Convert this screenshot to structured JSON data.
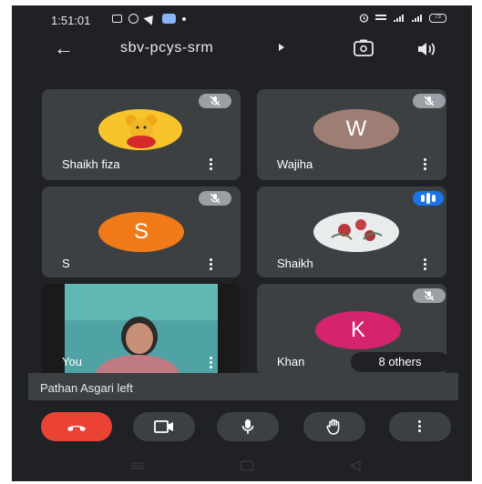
{
  "status_bar": {
    "time": "1:51:01",
    "net_label": "VoLTE",
    "battery": "73"
  },
  "header": {
    "meeting_code": "sbv-pcys-srm",
    "back_icon": "arrow-left-icon",
    "camera_switch_icon": "camera-flip-icon",
    "audio_icon": "speaker-icon"
  },
  "participants": [
    {
      "name": "Shaikh fiza",
      "avatar": "cartoon-bear-photo",
      "muted": true
    },
    {
      "name": "Wajiha",
      "avatar_letter": "W",
      "avatar_color": "#9e7e74",
      "muted": true
    },
    {
      "name": "S",
      "avatar_letter": "S",
      "avatar_color": "#f07a18",
      "muted": true
    },
    {
      "name": "Shaikh",
      "avatar": "flowers-photo",
      "speaking": true
    },
    {
      "name": "You",
      "avatar": "camera-video"
    },
    {
      "name": "Khan",
      "avatar_letter": "K",
      "avatar_color": "#d5236d",
      "muted": true
    }
  ],
  "others_chip": "8 others",
  "toast": "Pathan Asgari left",
  "controls": {
    "end_call": "end-call-icon",
    "camera": "video-camera-icon",
    "mic": "microphone-icon",
    "raise_hand": "hand-icon",
    "more": "more-vert-icon"
  },
  "colors": {
    "background": "#202124",
    "tile": "#3c4043",
    "end_call": "#ea4335",
    "speaking": "#1a73e8"
  }
}
